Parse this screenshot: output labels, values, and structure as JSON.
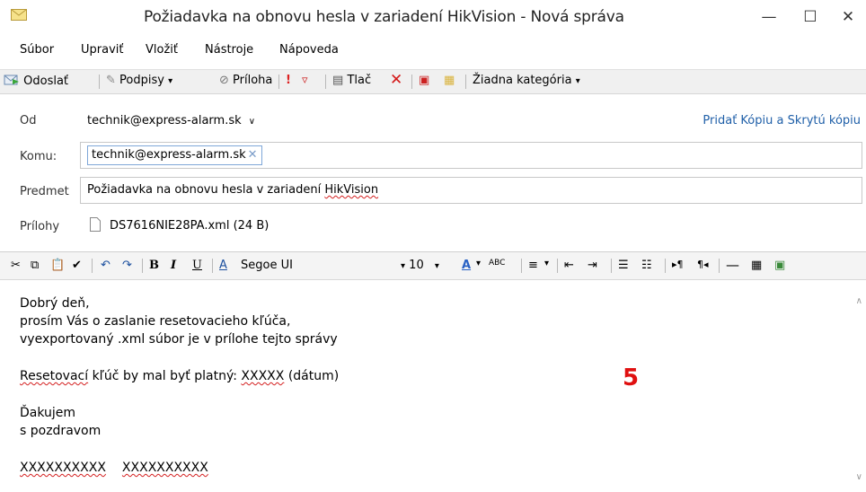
{
  "window": {
    "title": "Požiadavka na obnovu hesla v zariadení HikVision - Nová správa",
    "minimize": "—",
    "maximize": "☐",
    "close": "✕"
  },
  "menu": [
    "Súbor",
    "Upraviť",
    "Vložiť",
    "Nástroje",
    "Nápoveda"
  ],
  "toolbar": {
    "send": "Odoslať",
    "signatures": "Podpisy",
    "attachment": "Príloha",
    "print": "Tlač",
    "category": "Žiadna kategória"
  },
  "header": {
    "from_label": "Od",
    "from_value": "technik@express-alarm.sk",
    "cc_link": "Pridať Kópiu a Skrytú kópiu",
    "to_label": "Komu:",
    "to_chip": "technik@express-alarm.sk",
    "subject_label": "Predmet",
    "subject_value_a": "Požiadavka na obnovu hesla v zariadení ",
    "subject_value_b": "HikVision",
    "attachments_label": "Prílohy",
    "attachment_file": "DS7616NIE28PA.xml (24 B)"
  },
  "editor": {
    "font_name": "Segoe UI",
    "font_size": "10"
  },
  "body": {
    "line1": "Dobrý deň,",
    "line2": "prosím Vás o zaslanie resetovacieho kľúča,",
    "line3": "vyexportovaný .xml súbor je v prílohe tejto správy",
    "line4a": "Resetovací",
    "line4b": " kľúč by mal byť platný: ",
    "line4c": "XXXXX",
    "line4d": " (dátum)",
    "line5": "Ďakujem",
    "line6": "s pozdravom",
    "line7a": "XXXXXXXXXX",
    "line7b": "XXXXXXXXXX"
  },
  "annotation": "5"
}
